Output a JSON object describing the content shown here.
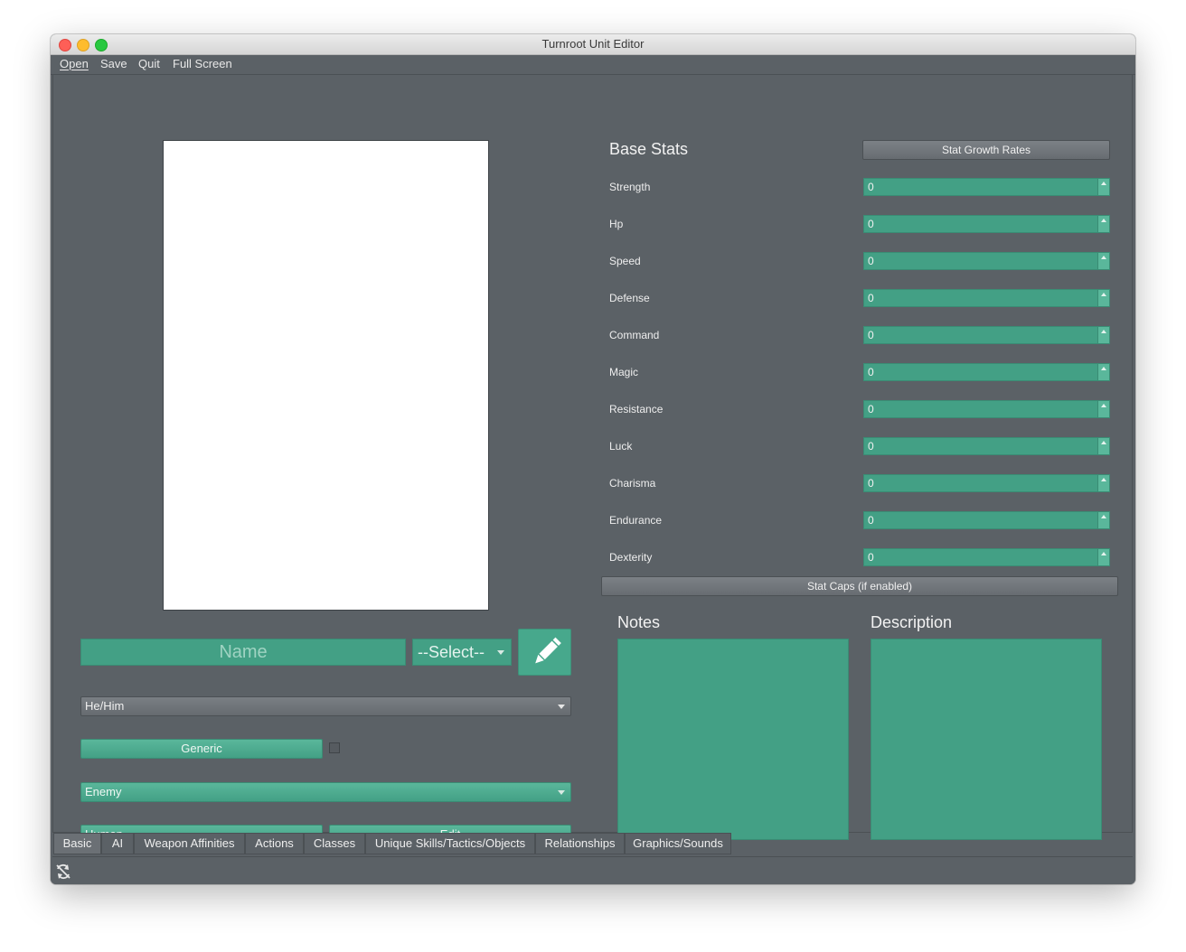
{
  "window": {
    "title": "Turnroot Unit Editor"
  },
  "menu": [
    "Open",
    "Save",
    "Quit",
    "Full Screen"
  ],
  "unit": {
    "name_placeholder": "Name",
    "select_label": "--Select--",
    "pronoun": "He/Him",
    "generic_label": "Generic",
    "generic_checked": false,
    "allegiance": "Enemy",
    "race": "Human",
    "race_edit_label": "Edit"
  },
  "stats": {
    "title": "Base Stats",
    "growth_button": "Stat Growth Rates",
    "caps_button": "Stat Caps (if enabled)",
    "items": [
      {
        "label": "Strength",
        "value": "0"
      },
      {
        "label": "Hp",
        "value": "0"
      },
      {
        "label": "Speed",
        "value": "0"
      },
      {
        "label": "Defense",
        "value": "0"
      },
      {
        "label": "Command",
        "value": "0"
      },
      {
        "label": "Magic",
        "value": "0"
      },
      {
        "label": "Resistance",
        "value": "0"
      },
      {
        "label": "Luck",
        "value": "0"
      },
      {
        "label": "Charisma",
        "value": "0"
      },
      {
        "label": "Endurance",
        "value": "0"
      },
      {
        "label": "Dexterity",
        "value": "0"
      }
    ]
  },
  "notes": {
    "title": "Notes"
  },
  "description": {
    "title": "Description"
  },
  "tabs": [
    "Basic",
    "AI",
    "Weapon Affinities",
    "Actions",
    "Classes",
    "Unique Skills/Tactics/Objects",
    "Relationships",
    "Graphics/Sounds"
  ],
  "active_tab": "Basic",
  "icons": {
    "edit": "pencil-icon",
    "status": "sync-disabled-icon"
  },
  "colors": {
    "accent_teal": "#43a085",
    "background": "#5b6166"
  }
}
